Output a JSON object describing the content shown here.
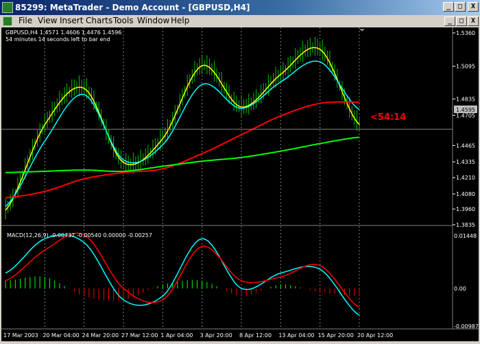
{
  "window": {
    "title": "85299: MetaTrader - Demo Account - [GBPUSD,H4]",
    "minimize_glyph": "_",
    "maximize_glyph": "□",
    "close_glyph": "X"
  },
  "menu": {
    "items": [
      "File",
      "View",
      "Insert",
      "Charts",
      "Tools",
      "Window",
      "Help"
    ]
  },
  "chart": {
    "info_line": "GBPUSD,H4 1.4571 1.4606 1.4476 1.4596",
    "timer_line": "54 minutes 14 seconds left to bar end",
    "countdown": "<54:14",
    "current_price_label": "1.4595",
    "price_axis": [
      "1.5360",
      "1.5095",
      "1.4835",
      "1.4705",
      "1.4465",
      "1.4335",
      "1.4210",
      "1.4080",
      "1.3960",
      "1.3835"
    ],
    "time_axis": [
      "17 Mar 2003",
      "20 Mar 04:00",
      "24 Mar 20:00",
      "27 Mar 12:00",
      "1 Apr 04:00",
      "3 Apr 20:00",
      "8 Apr 12:00",
      "13 Apr 04:00",
      "15 Apr 20:00",
      "20 Apr 12:00"
    ],
    "macd_header": "MACD(12,26,9) -0.00737 -0.00540 0.00000 -0.00257",
    "macd_axis": [
      "0.01448",
      "0.00",
      "-0.00987"
    ]
  },
  "colors": {
    "background": "#000000",
    "grid": "#808080",
    "price_bars": "#00c000",
    "ma_fast": "#ffff00",
    "ma_mid": "#00ffff",
    "ma_slow": "#ff0000",
    "ma_long": "#00ff00",
    "countdown": "#ff0000",
    "hist_pos": "#00ff00",
    "hist_neg": "#ff0000"
  },
  "chart_data": {
    "type": "line",
    "symbol": "GBPUSD",
    "timeframe": "H4",
    "title": "GBPUSD,H4",
    "ylim": [
      1.3835,
      1.536
    ],
    "x": [
      "17 Mar 2003",
      "20 Mar 04:00",
      "24 Mar 20:00",
      "27 Mar 12:00",
      "1 Apr 04:00",
      "3 Apr 20:00",
      "8 Apr 12:00",
      "13 Apr 04:00",
      "15 Apr 20:00",
      "20 Apr 12:00"
    ],
    "series": [
      {
        "values": [
          1.395,
          1.463,
          1.492,
          1.433,
          1.452,
          1.51,
          1.477,
          1.503,
          1.523,
          1.463
        ]
      },
      {
        "values": [
          1.398,
          1.45,
          1.487,
          1.435,
          1.447,
          1.495,
          1.476,
          1.497,
          1.513,
          1.475
        ]
      },
      {
        "values": [
          1.405,
          1.41,
          1.42,
          1.425,
          1.428,
          1.44,
          1.455,
          1.47,
          1.48,
          1.481
        ]
      },
      {
        "values": [
          1.425,
          1.426,
          1.427,
          1.426,
          1.43,
          1.434,
          1.437,
          1.442,
          1.448,
          1.453
        ]
      }
    ],
    "macd": {
      "values": [
        0.004,
        0.013,
        0.012,
        -0.003,
        -0.002,
        0.013,
        0.0,
        0.004,
        0.005,
        -0.007
      ],
      "signal": [
        0.002,
        0.01,
        0.014,
        0.0,
        -0.003,
        0.011,
        0.002,
        0.003,
        0.006,
        -0.005
      ],
      "histogram": [
        0.002,
        0.003,
        -0.002,
        -0.003,
        0.001,
        0.002,
        -0.002,
        0.001,
        -0.001,
        -0.002
      ],
      "ylim": [
        -0.00987,
        0.01448
      ]
    }
  }
}
